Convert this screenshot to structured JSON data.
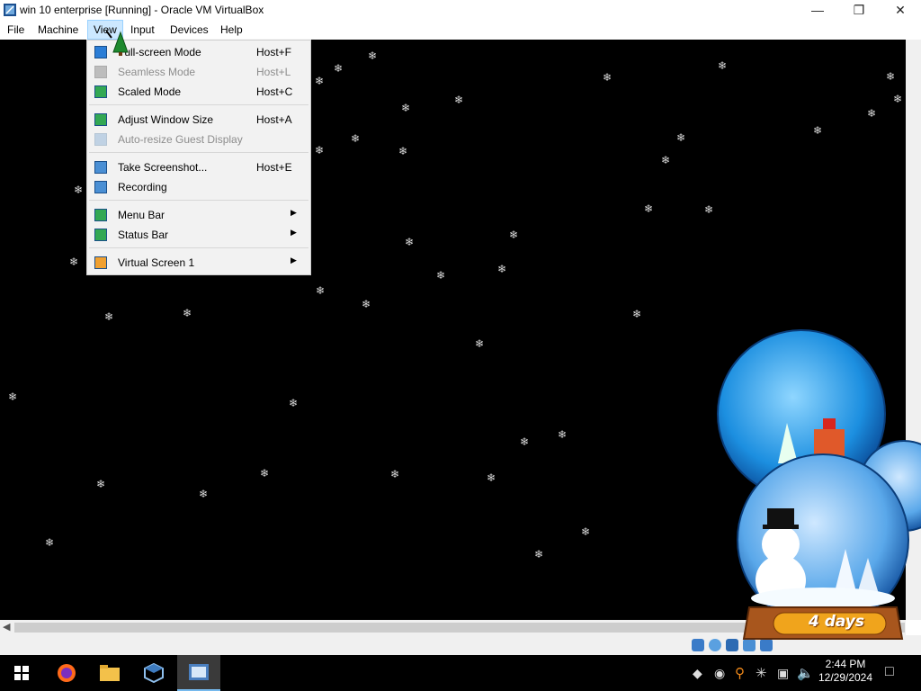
{
  "window": {
    "title": "win 10 enterprise [Running] - Oracle VM VirtualBox",
    "controls": [
      "minimize",
      "maximize",
      "close"
    ]
  },
  "menubar": {
    "items": [
      {
        "label": "File"
      },
      {
        "label": "Machine"
      },
      {
        "label": "View",
        "open": true
      },
      {
        "label": "Input"
      },
      {
        "label": "Devices"
      },
      {
        "label": "Help"
      }
    ]
  },
  "view_menu": {
    "items": [
      {
        "label": "Full-screen Mode",
        "shortcut": "Host+F",
        "enabled": true,
        "icon": "fullscreen-icon"
      },
      {
        "label": "Seamless Mode",
        "shortcut": "Host+L",
        "enabled": false,
        "icon": "seamless-icon"
      },
      {
        "label": "Scaled Mode",
        "shortcut": "Host+C",
        "enabled": true,
        "icon": "scaled-icon"
      },
      {
        "label": "Adjust Window Size",
        "shortcut": "Host+A",
        "enabled": true,
        "icon": "adjust-window-icon"
      },
      {
        "label": "Auto-resize Guest Display",
        "shortcut": "",
        "enabled": false,
        "icon": "auto-resize-icon"
      },
      {
        "label": "Take Screenshot...",
        "shortcut": "Host+E",
        "enabled": true,
        "icon": "screenshot-icon"
      },
      {
        "label": "Recording",
        "shortcut": "",
        "enabled": true,
        "icon": "recording-icon"
      },
      {
        "label": "Menu Bar",
        "shortcut": "",
        "enabled": true,
        "submenu": true,
        "icon": "menu-bar-icon"
      },
      {
        "label": "Status Bar",
        "shortcut": "",
        "enabled": true,
        "submenu": true,
        "icon": "status-bar-icon"
      },
      {
        "label": "Virtual Screen 1",
        "shortcut": "",
        "enabled": true,
        "submenu": true,
        "icon": "virtual-screen-icon"
      }
    ]
  },
  "desktop": {
    "widget_label": "4 days"
  },
  "taskbar": {
    "apps": [
      "windows-start-icon",
      "firefox-icon",
      "file-explorer-icon",
      "virtualbox-icon",
      "vm-window-icon"
    ],
    "time": "2:44 PM",
    "date": "12/29/2024"
  },
  "colors": {
    "menu_bg": "#f2f2f2",
    "menu_highlight": "#cce8ff",
    "guest_bg": "#000000",
    "taskbar_bg": "#000000"
  }
}
